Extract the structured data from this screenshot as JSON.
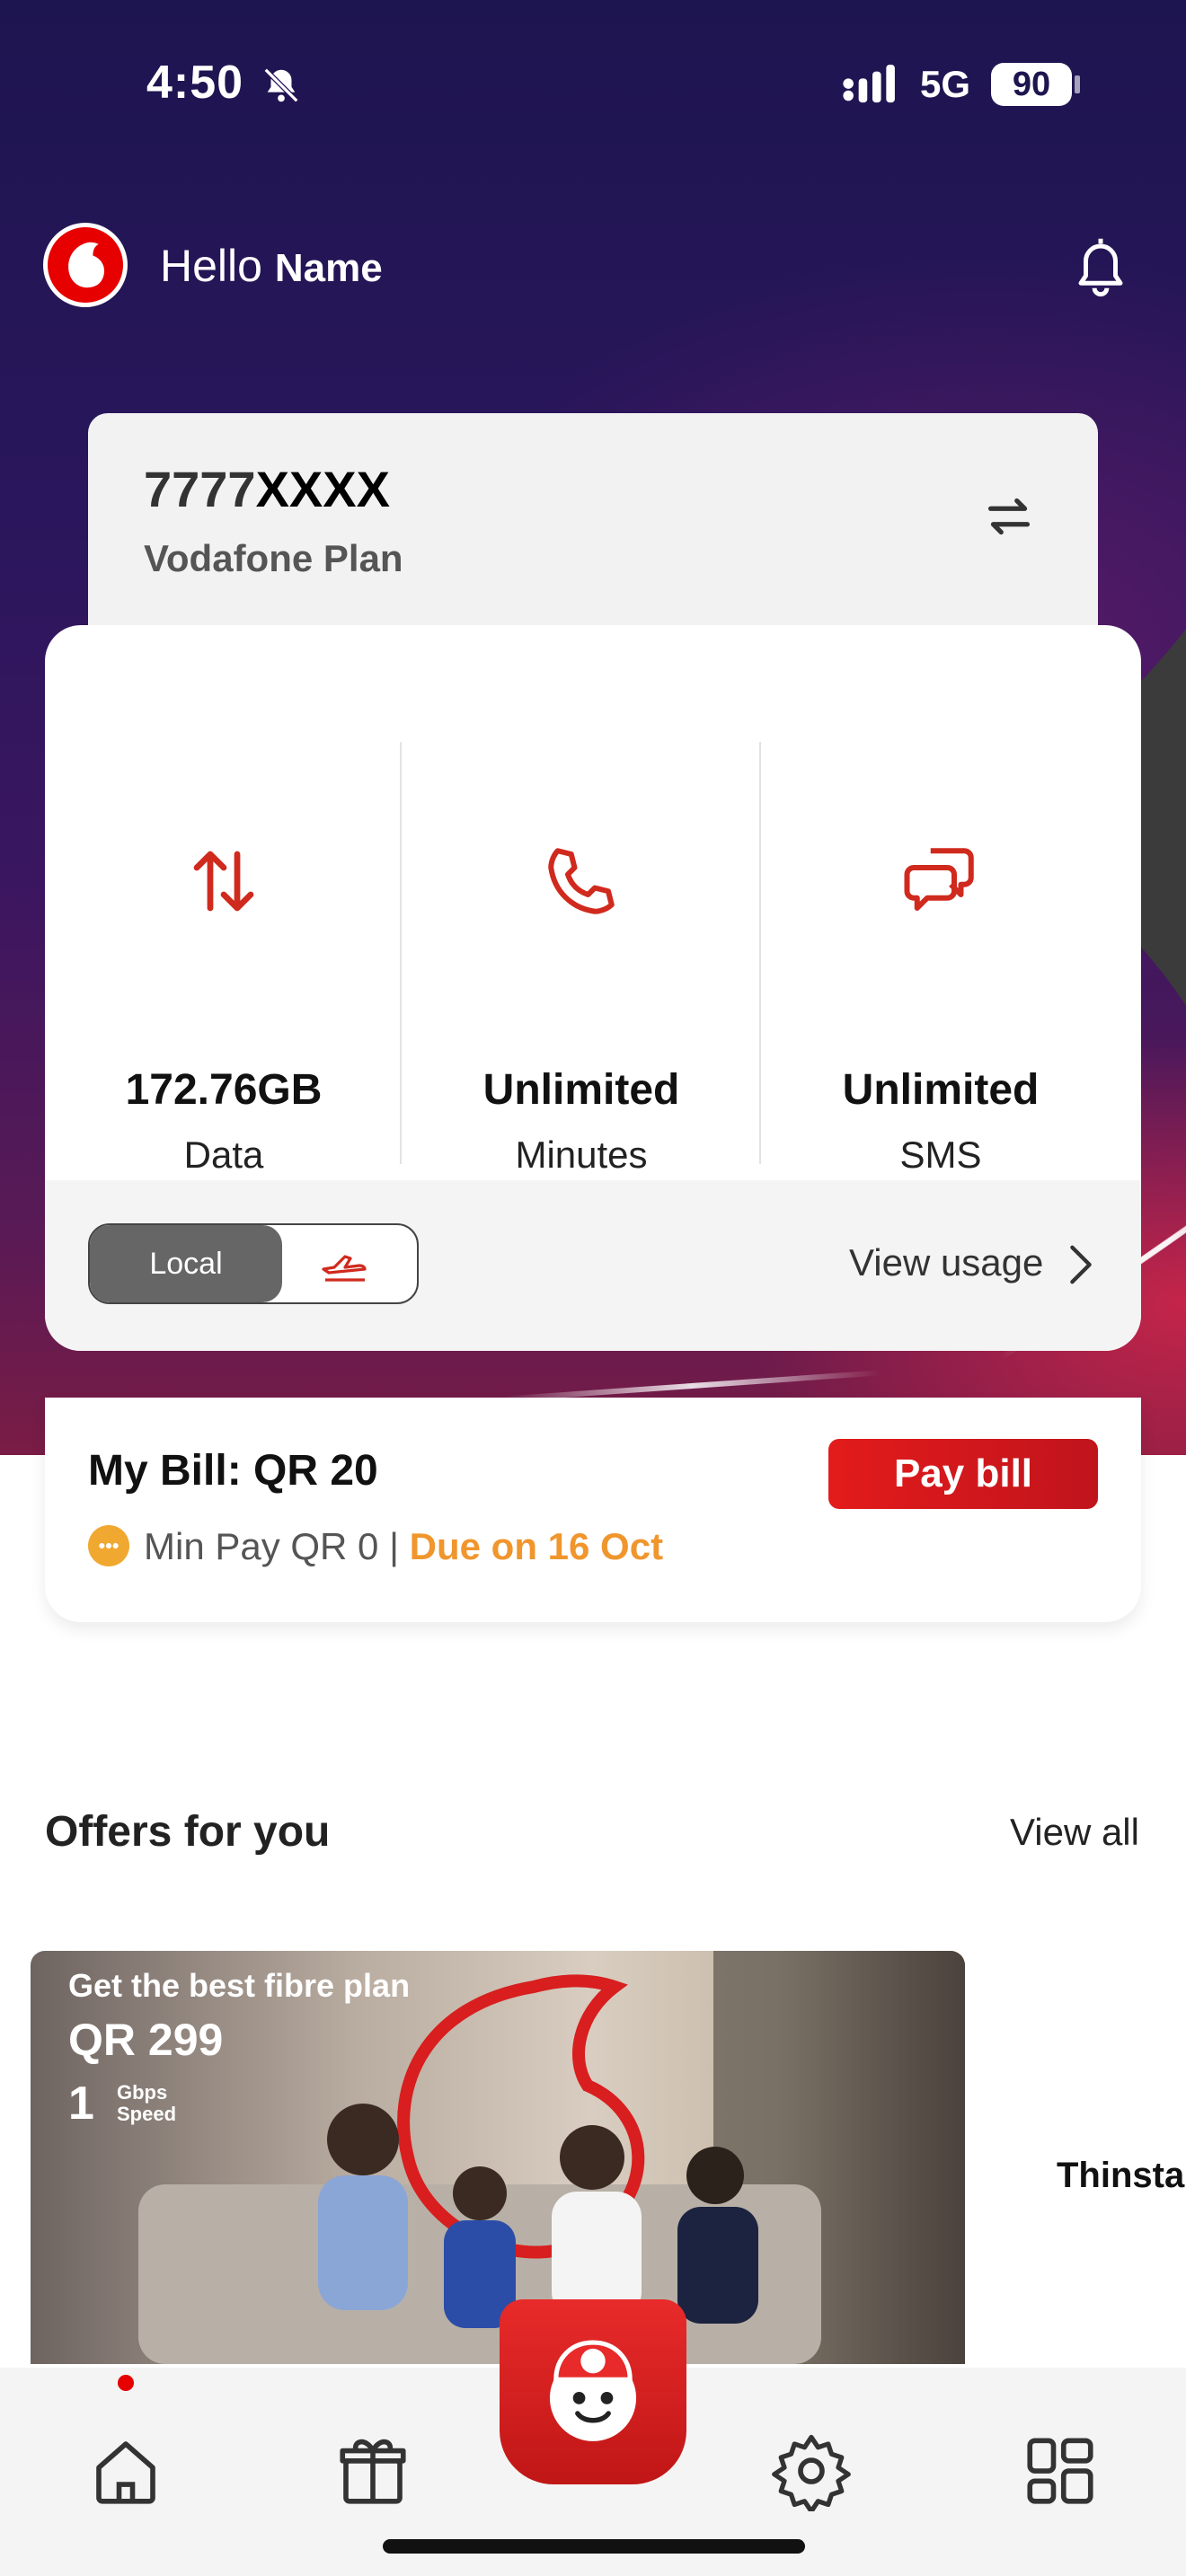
{
  "status_bar": {
    "time": "4:50",
    "network": "5G",
    "battery": "90"
  },
  "header": {
    "greeting": "Hello",
    "name": "Name"
  },
  "account": {
    "number_prefix": "7777",
    "number_masked": "XXXX",
    "plan": "Vodafone Plan"
  },
  "usage": {
    "items": [
      {
        "value": "172.76GB",
        "label": "Data",
        "icon": "data-arrows-icon"
      },
      {
        "value": "Unlimited",
        "label": "Minutes",
        "icon": "phone-icon"
      },
      {
        "value": "Unlimited",
        "label": "SMS",
        "icon": "chat-bubbles-icon"
      }
    ],
    "toggle_local": "Local",
    "view_usage": "View usage"
  },
  "bill": {
    "title": "My Bill: QR 20",
    "min_pay": "Min Pay QR 0 | ",
    "due": "Due on 16 Oct",
    "pay_button": "Pay bill"
  },
  "offers": {
    "title": "Offers for you",
    "view_all": "View all",
    "card": {
      "line1": "Get the best fibre plan",
      "line2": "QR 299",
      "speed_value": "1",
      "speed_unit_1": "Gbps",
      "speed_unit_2": "Speed"
    },
    "peek_text": "Thinsta"
  },
  "colors": {
    "brand": "#e60000",
    "due": "#f0962d",
    "hero_top": "#1d1550"
  }
}
